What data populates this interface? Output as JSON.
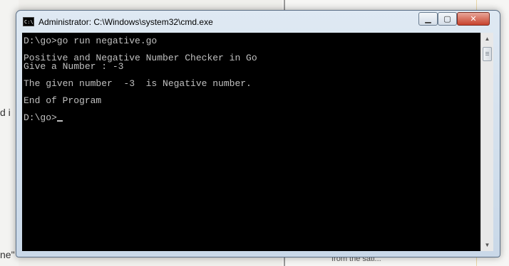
{
  "background": {
    "left_fragment_1": "d i",
    "left_fragment_2": "ne\"",
    "right_fragment": "from the sati..."
  },
  "window": {
    "title": "Administrator: C:\\Windows\\system32\\cmd.exe",
    "icon_label": "C:\\",
    "controls": {
      "minimize": "▁",
      "maximize": "▢",
      "close": "✕"
    }
  },
  "console": {
    "lines": [
      "D:\\go>go run negative.go",
      "",
      "Positive and Negative Number Checker in Go",
      "Give a Number : -3",
      "",
      "The given number  -3  is Negative number.",
      "",
      "End of Program",
      "",
      "D:\\go>"
    ]
  },
  "scrollbar": {
    "up_arrow": "▲",
    "down_arrow": "▼"
  }
}
